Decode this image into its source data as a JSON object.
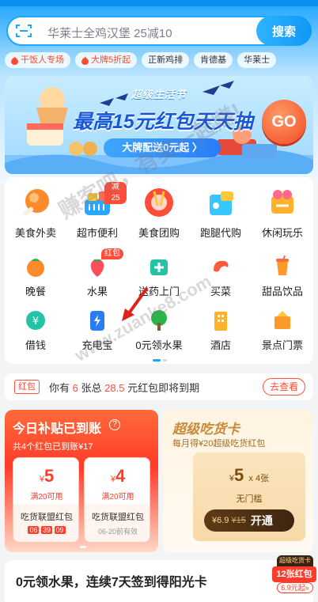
{
  "search": {
    "placeholder": "华莱士全鸡汉堡 25减10",
    "button_label": "搜索"
  },
  "tags": [
    {
      "label": "干饭人专场",
      "hot": true
    },
    {
      "label": "大牌5折起",
      "hot": true
    },
    {
      "label": "正新鸡排",
      "hot": false
    },
    {
      "label": "肯德基",
      "hot": false
    },
    {
      "label": "华莱士",
      "hot": false
    }
  ],
  "banner": {
    "subtitle": "超级生活节",
    "title": "最高15元红包天天抽",
    "pill": "大牌配送0元起 〉",
    "go": "GO"
  },
  "categories_main": [
    {
      "label": "美食外卖",
      "icon": "fried-chicken-icon",
      "color": "#ff8a2a"
    },
    {
      "label": "超市便利",
      "icon": "shopping-basket-icon",
      "color": "#2aa8ff",
      "badge": "减25"
    },
    {
      "label": "美食团购",
      "icon": "food-group-icon",
      "color": "#ff4d3a"
    },
    {
      "label": "跑腿代购",
      "icon": "delivery-bag-icon",
      "color": "#37c6ff"
    },
    {
      "label": "休闲玩乐",
      "icon": "leisure-icon",
      "color": "#ffb12a"
    }
  ],
  "categories_small": [
    {
      "label": "晚餐",
      "icon": "dinner-icon",
      "color": "#ff8a2a"
    },
    {
      "label": "水果",
      "icon": "strawberry-icon",
      "color": "#ff4d5a",
      "badge": "红包"
    },
    {
      "label": "送药上门",
      "icon": "medicine-icon",
      "color": "#22c3a6"
    },
    {
      "label": "买菜",
      "icon": "shrimp-icon",
      "color": "#ff5a3a"
    },
    {
      "label": "甜品饮品",
      "icon": "drink-icon",
      "color": "#ff9a2a"
    },
    {
      "label": "借钱",
      "icon": "yuan-coin-icon",
      "color": "#22c3a6"
    },
    {
      "label": "充电宝",
      "icon": "power-bank-icon",
      "color": "#2a7cf5"
    },
    {
      "label": "0元领水果",
      "icon": "tree-icon",
      "color": "#2ab54a"
    },
    {
      "label": "酒店",
      "icon": "hotel-icon",
      "color": "#ffb12a"
    },
    {
      "label": "景点门票",
      "icon": "ticket-icon",
      "color": "#ff9a2a"
    }
  ],
  "redpacket_bar": {
    "tag": "红包",
    "text_prefix": "你有",
    "count": "6",
    "text_mid": "张总",
    "amount": "28.5",
    "text_suffix": "元红包即将到期",
    "button": "去查看"
  },
  "subsidy": {
    "title": "今日补贴已到账",
    "help": "?",
    "desc": "共4个红包已到账¥17",
    "coupons": [
      {
        "amount": "5",
        "currency": "¥",
        "condition": "满20可用",
        "name": "吃货联盟红包",
        "time": [
          "06",
          "39",
          "09"
        ]
      },
      {
        "amount": "4",
        "currency": "¥",
        "condition": "满20可用",
        "name": "吃货联盟红包",
        "expire": "06-20前有效"
      }
    ]
  },
  "foodie": {
    "title": "超级吃货卡",
    "subtitle": "每月得¥20超级吃货红包",
    "amount": "5",
    "currency": "¥",
    "multiplier": "x 4张",
    "min": "无门槛",
    "price": "¥6.9",
    "original_price": "¥15",
    "button": "开通"
  },
  "bottom": {
    "title": "0元领水果，连续7天签到得阳光卡"
  },
  "float_badge": {
    "top": "超级吃货卡",
    "mid": "12张红包",
    "bot": "6.9元起»"
  },
  "watermark": {
    "line1": "赚客吧，有奖一起赚!",
    "line2": "www.zuanke8.com"
  }
}
